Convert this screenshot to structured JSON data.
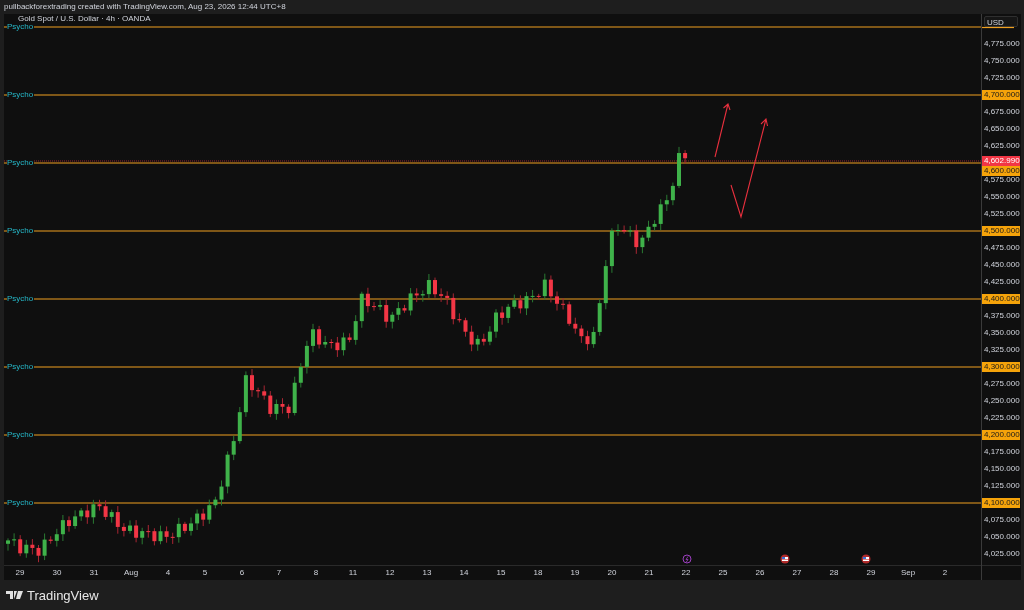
{
  "attribution": "pullbackforextrading created with TradingView.com, Aug 23, 2026 12:44 UTC+8",
  "chart": {
    "title": "Gold Spot / U.S. Dollar · 4h · OANDA",
    "currency": "USD"
  },
  "horizontal_lines": [
    {
      "label": "Psycho"
    },
    {
      "label": "Psycho",
      "axis_label": "4,700.000"
    },
    {
      "label": "Psycho",
      "axis_label": "4,600.000"
    },
    {
      "label": "Psycho",
      "axis_label": "4,500.000"
    },
    {
      "label": "Psycho",
      "axis_label": "4,400.000"
    },
    {
      "label": "Psycho",
      "axis_label": "4,300.000"
    },
    {
      "label": "Psycho",
      "axis_label": "4,200.000"
    },
    {
      "label": "Psycho",
      "axis_label": "4,100.000"
    }
  ],
  "last_price": "4,602.990",
  "price_ticks": [
    "4,775.000",
    "4,750.000",
    "4,725.000",
    "4,675.000",
    "4,650.000",
    "4,625.000",
    "4,575.000",
    "4,550.000",
    "4,525.000",
    "4,475.000",
    "4,450.000",
    "4,425.000",
    "4,375.000",
    "4,350.000",
    "4,325.000",
    "4,275.000",
    "4,250.000",
    "4,225.000",
    "4,175.000",
    "4,150.000",
    "4,125.000",
    "4,075.000",
    "4,050.000",
    "4,025.000"
  ],
  "time_labels": [
    "29",
    "30",
    "31",
    "Aug",
    "4",
    "5",
    "6",
    "7",
    "8",
    "11",
    "12",
    "13",
    "14",
    "15",
    "18",
    "19",
    "20",
    "21",
    "22",
    "25",
    "26",
    "27",
    "28",
    "29",
    "Sep",
    "2"
  ],
  "events": [
    {
      "kind": "flash"
    },
    {
      "kind": "flag"
    },
    {
      "kind": "flag"
    }
  ],
  "logo": "TradingView"
}
